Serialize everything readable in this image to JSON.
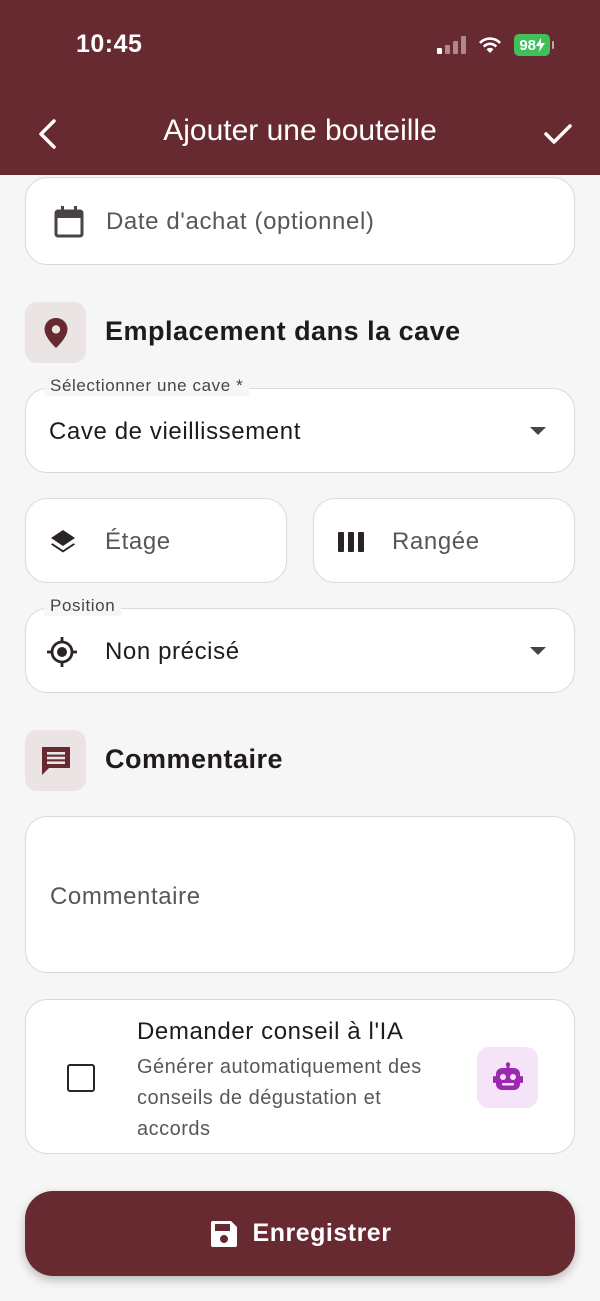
{
  "status_bar": {
    "time": "10:45",
    "battery": "98"
  },
  "nav": {
    "title": "Ajouter une bouteille"
  },
  "purchase_date": {
    "placeholder": "Date d'achat (optionnel)"
  },
  "location_section": {
    "title": "Emplacement dans la cave"
  },
  "cellar_select": {
    "label": "Sélectionner une cave *",
    "value": "Cave de vieillissement"
  },
  "floor_field": {
    "placeholder": "Étage"
  },
  "row_field": {
    "placeholder": "Rangée"
  },
  "position_select": {
    "label": "Position",
    "value": "Non précisé"
  },
  "comment_section": {
    "title": "Commentaire"
  },
  "comment_field": {
    "placeholder": "Commentaire"
  },
  "ai_advice": {
    "title": "Demander conseil à l'IA",
    "description": "Générer automatiquement des conseils de dégustation et accords",
    "checked": false
  },
  "save_button": {
    "label": "Enregistrer"
  },
  "colors": {
    "primary": "#672a31",
    "ai_accent": "#9c27b0"
  },
  "icons": [
    "chevron-left-icon",
    "check-icon",
    "calendar-icon",
    "location-pin-icon",
    "layers-icon",
    "columns-icon",
    "crosshair-icon",
    "comment-icon",
    "robot-icon",
    "save-icon"
  ]
}
